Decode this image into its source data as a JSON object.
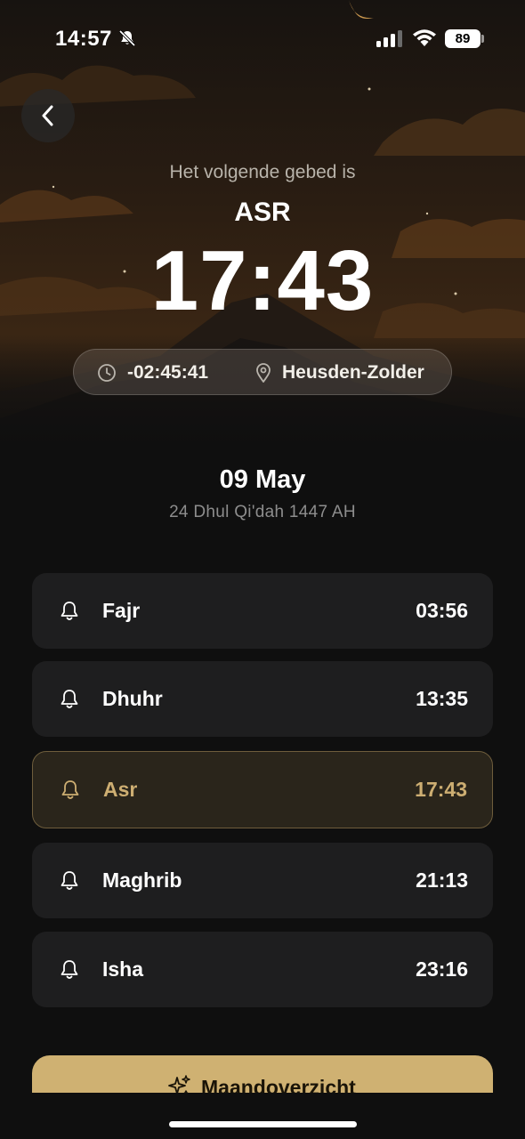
{
  "status_bar": {
    "time": "14:57",
    "battery": "89"
  },
  "header": {
    "next_label": "Het volgende gebed is",
    "next_prayer": "ASR",
    "next_time": "17:43",
    "countdown": "-02:45:41",
    "location": "Heusden-Zolder"
  },
  "date": {
    "gregorian": "09 May",
    "hijri": "24 Dhul Qi'dah 1447 AH"
  },
  "prayers": [
    {
      "name": "Fajr",
      "time": "03:56"
    },
    {
      "name": "Dhuhr",
      "time": "13:35"
    },
    {
      "name": "Asr",
      "time": "17:43",
      "active": true
    },
    {
      "name": "Maghrib",
      "time": "21:13"
    },
    {
      "name": "Isha",
      "time": "23:16"
    }
  ],
  "month_button": {
    "label": "Maandoverzicht"
  },
  "colors": {
    "background": "#0f0f0f",
    "card": "#1e1e1f",
    "accent": "#cfb172",
    "active_card": "#2a251b"
  },
  "icons": {
    "back": "chevron-left-icon",
    "mute": "bell-slash-icon",
    "clock": "clock-icon",
    "location": "map-pin-icon",
    "bell": "bell-icon",
    "sparkle": "sparkles-icon"
  }
}
